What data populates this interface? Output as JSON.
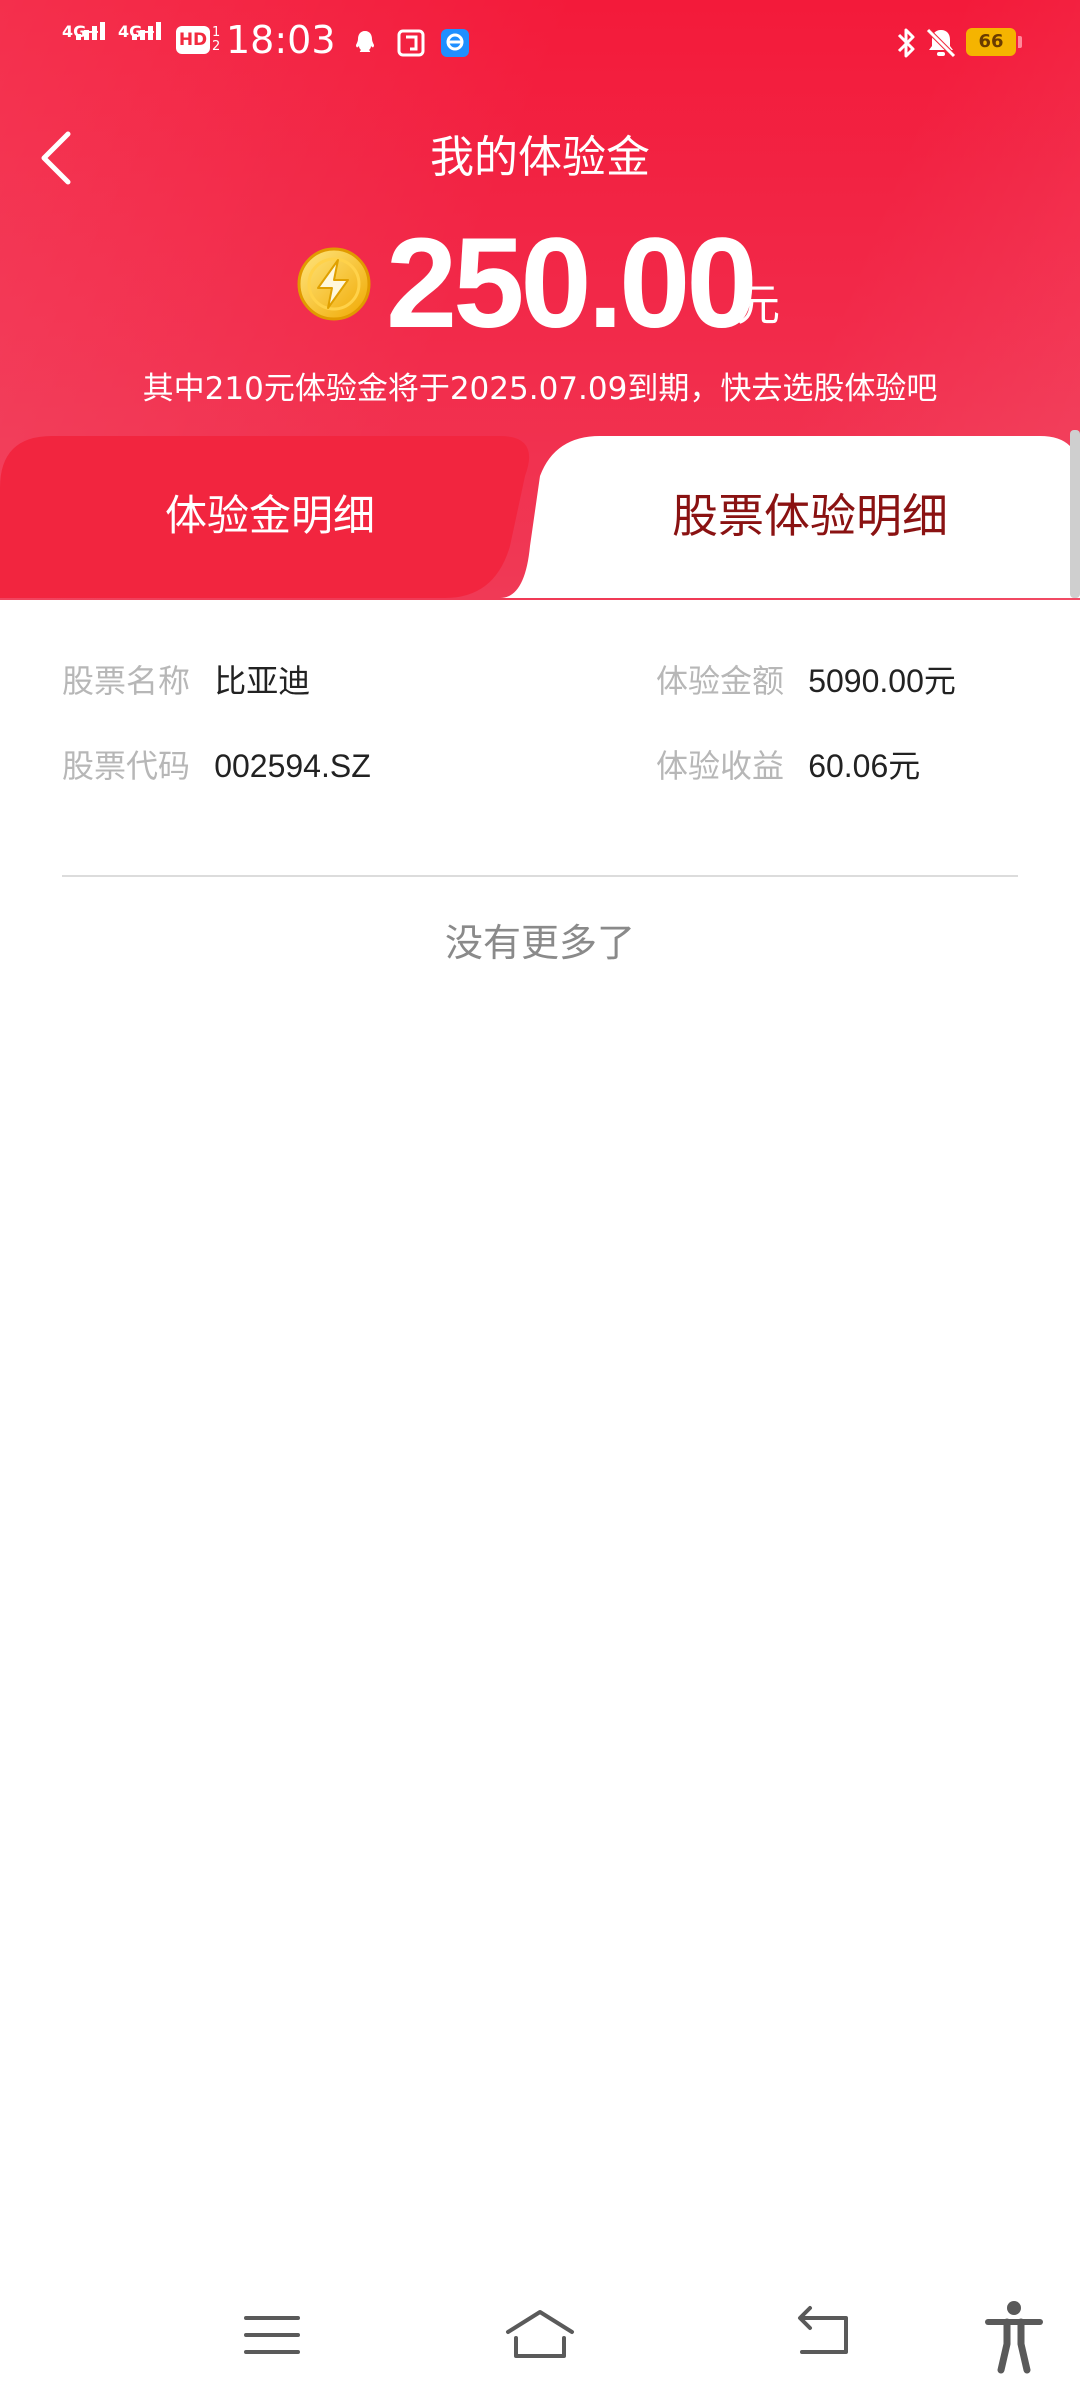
{
  "status_bar": {
    "network1": "4G+",
    "network2": "4G+",
    "hd_label": "HD",
    "hd_sub1": "1",
    "hd_sub2": "2",
    "time": "18:03",
    "battery": "66"
  },
  "header": {
    "title": "我的体验金",
    "amount": "250.00",
    "amount_unit": "元",
    "notice": "其中210元体验金将于2025.07.09到期，快去选股体验吧"
  },
  "tabs": {
    "left_label": "体验金明细",
    "right_label": "股票体验明细",
    "active": "股票体验明细"
  },
  "stock_detail": {
    "name_label": "股票名称",
    "name_value": "比亚迪",
    "code_label": "股票代码",
    "code_value": "002594.SZ",
    "amount_label": "体验金额",
    "amount_value": "5090.00元",
    "income_label": "体验收益",
    "income_value": "60.06元"
  },
  "footer": {
    "no_more": "没有更多了"
  },
  "colors": {
    "header_red": "#f22a3e",
    "active_tab_text": "#8a1212",
    "label_gray": "#b7b7b7"
  },
  "icons": {
    "back": "chevron-left-icon",
    "coin": "lightning-coin-icon",
    "nav_menu": "menu-icon",
    "nav_home": "home-icon",
    "nav_back": "back-arrow-icon",
    "nav_accessibility": "accessibility-icon"
  }
}
